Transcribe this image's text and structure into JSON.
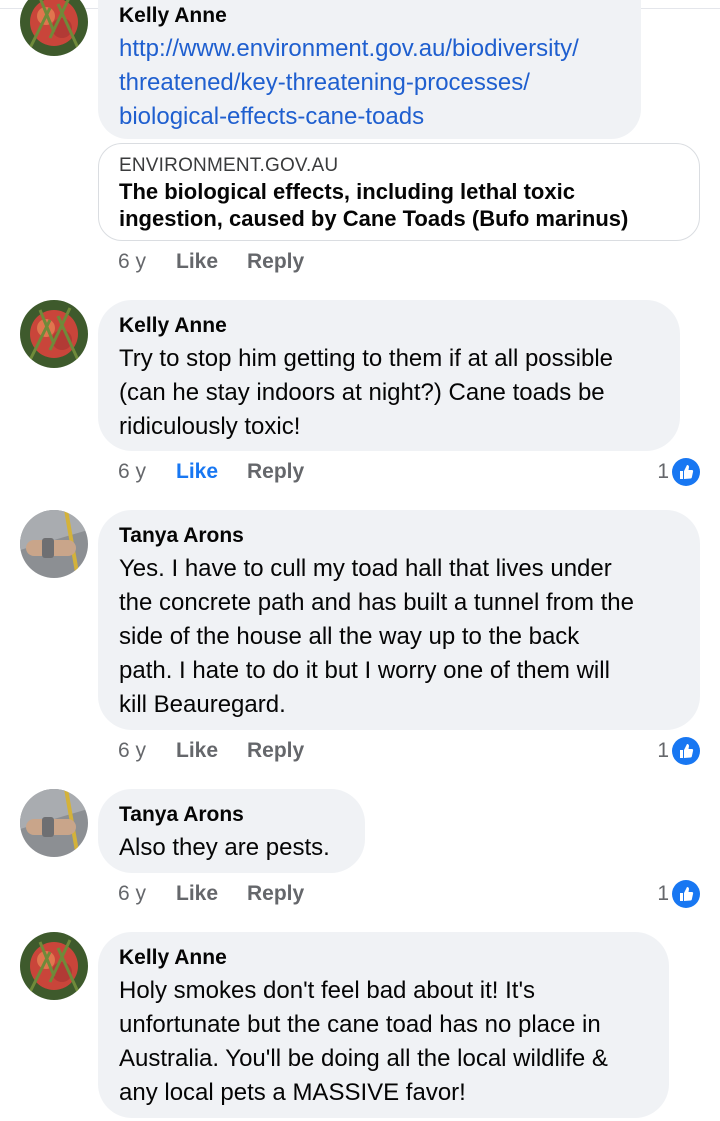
{
  "comments": [
    {
      "author": "Kelly Anne",
      "link_lines": [
        "http://www.environment.gov.au/biodiversity/",
        "threatened/key-threatening-processes/",
        "biological-effects-cane-toads"
      ],
      "preview": {
        "domain": "ENVIRONMENT.GOV.AU",
        "title_lines": [
          "The biological effects, including lethal toxic",
          "ingestion, caused by Cane Toads (Bufo marinus)"
        ]
      },
      "time": "6 y",
      "like": "Like",
      "reply": "Reply"
    },
    {
      "author": "Kelly Anne",
      "text_lines": [
        "Try to stop him getting to them if at all possible",
        "(can he stay indoors at night?) Cane toads be",
        "ridiculously toxic!"
      ],
      "time": "6 y",
      "like": "Like",
      "reply": "Reply",
      "reactions": "1"
    },
    {
      "author": "Tanya Arons",
      "text_lines": [
        "Yes.  I have to cull my toad hall that lives under",
        "the concrete path and has built a tunnel from the",
        "side of the house all the way up to the back",
        "path.  I hate to do it but I worry one of them will",
        "kill Beauregard."
      ],
      "time": "6 y",
      "like": "Like",
      "reply": "Reply",
      "reactions": "1"
    },
    {
      "author": "Tanya Arons",
      "text_lines": [
        "Also they are pests."
      ],
      "time": "6 y",
      "like": "Like",
      "reply": "Reply",
      "reactions": "1"
    },
    {
      "author": "Kelly Anne",
      "text_lines": [
        "Holy smokes don't feel bad about it! It's",
        "unfortunate but the cane toad has no place in",
        "Australia. You'll be doing all the local wildlife &",
        "any local pets a MASSIVE favor!"
      ]
    }
  ],
  "colors": {
    "link": "#1f5fcf",
    "like_active": "#1877f2",
    "bubble": "#f0f2f5",
    "meta": "#65676b"
  },
  "icons": {
    "reaction": "thumbs-up-icon"
  }
}
